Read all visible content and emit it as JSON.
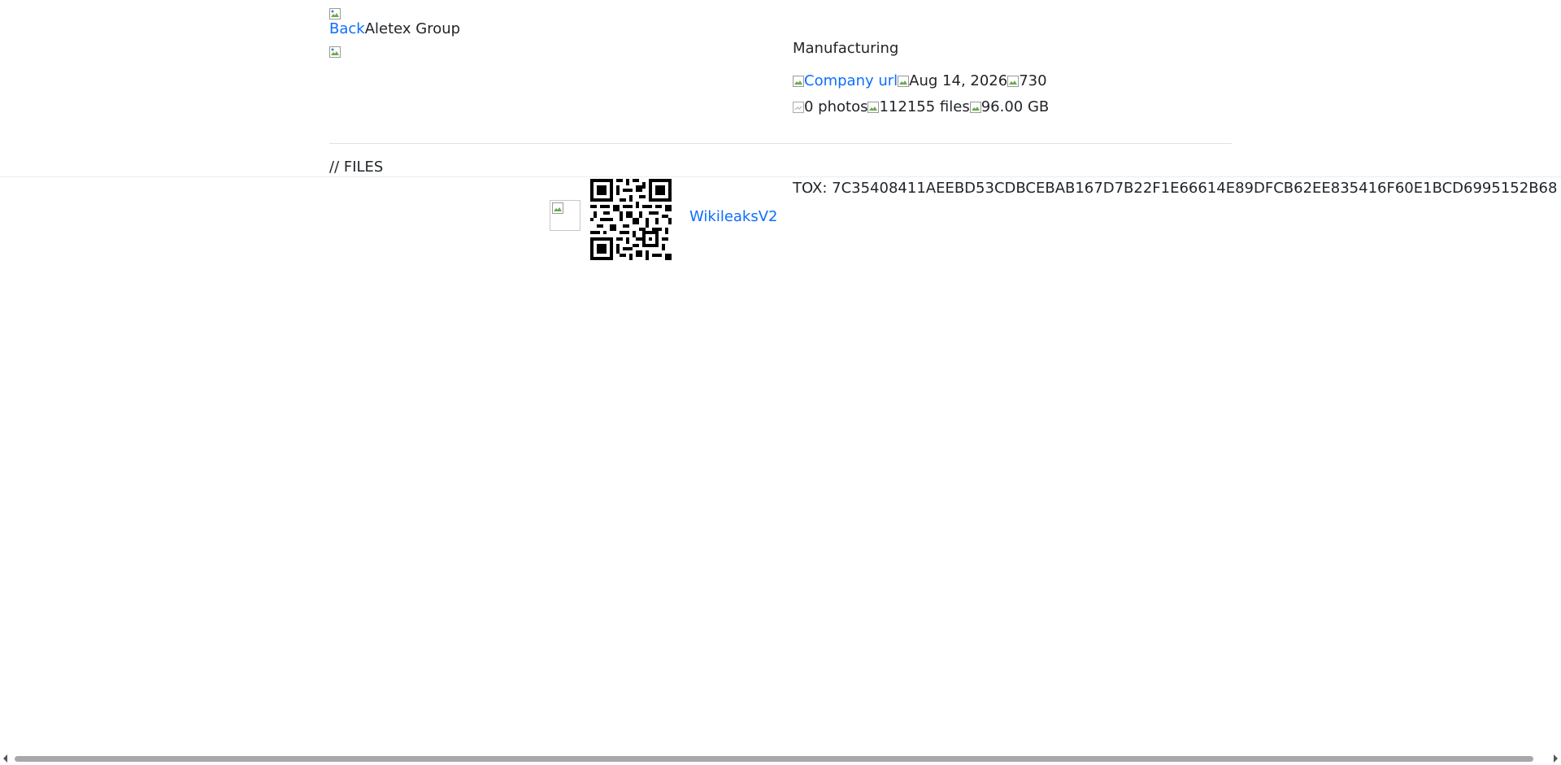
{
  "header": {
    "back_label": "Back",
    "company_name": "Aletex Group"
  },
  "company": {
    "industry": "Manufacturing",
    "url_label": "Company url",
    "date": "Aug 14, 2026",
    "views": "730",
    "photos": "0 photos",
    "files": "112155 files",
    "size": "96.00 GB"
  },
  "files_section": {
    "heading": "// FILES"
  },
  "contact": {
    "link_label": "WikileaksV2",
    "tox": "TOX: 7C35408411AEEBD53CDBCEBAB167D7B22F1E66614E89DFCB62EE835416F60E1BCD6995152B68"
  }
}
